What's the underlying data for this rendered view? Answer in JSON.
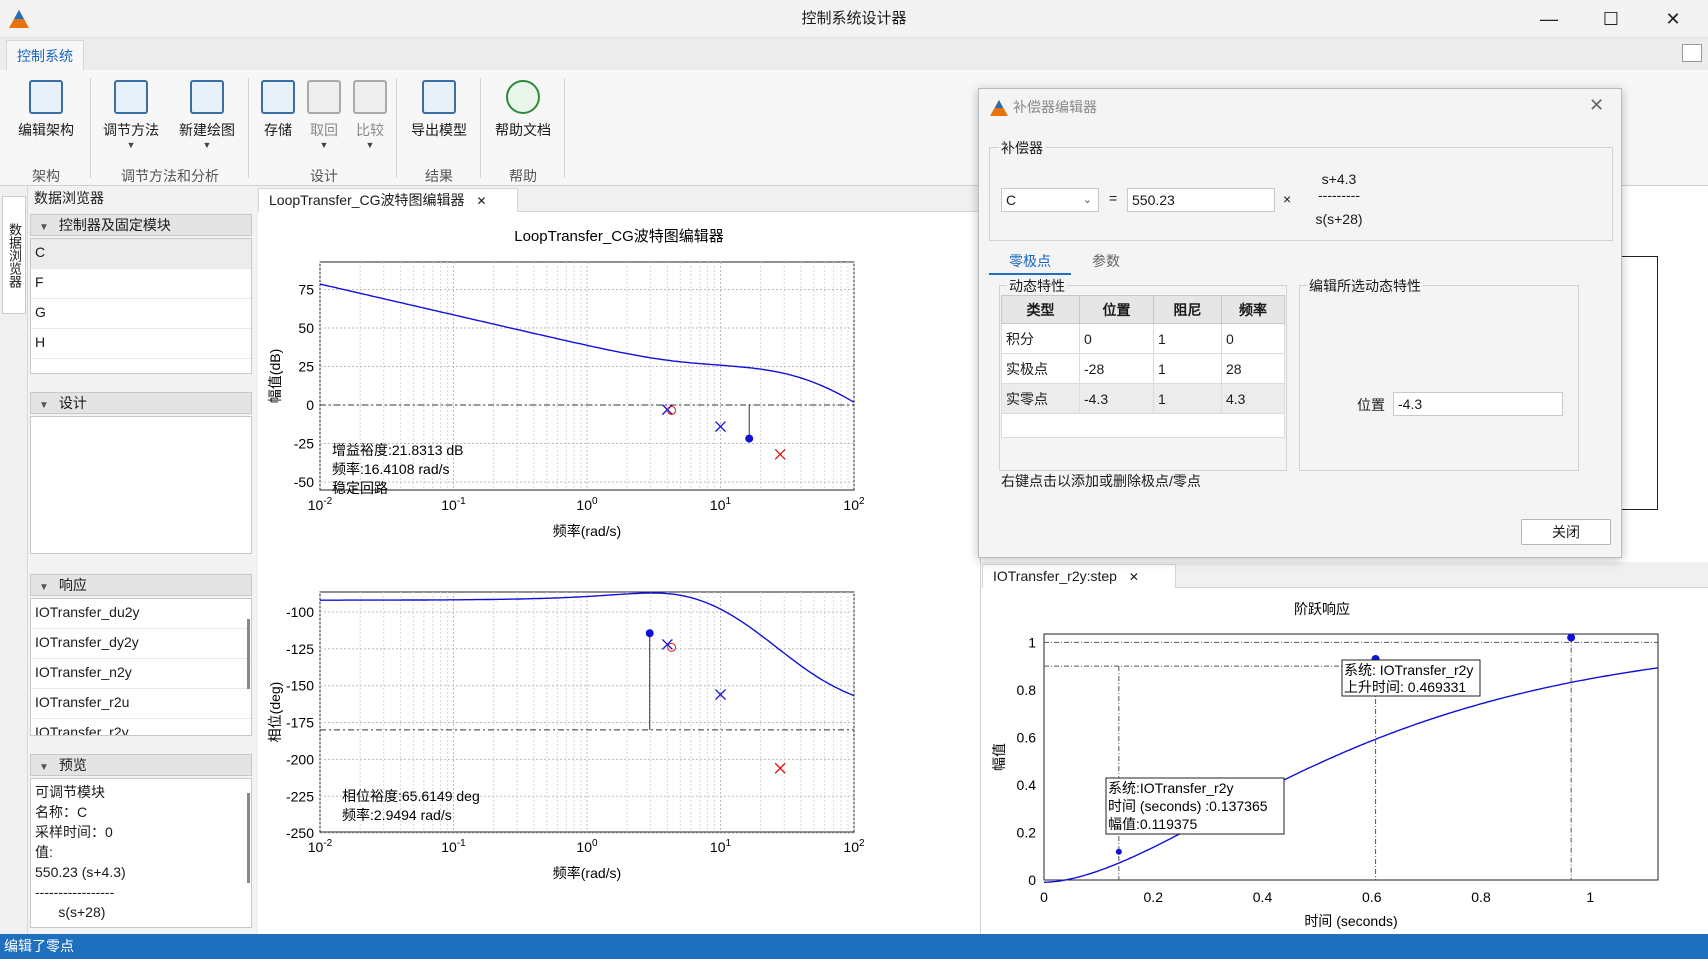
{
  "window": {
    "title": "控制系统设计器",
    "minimize": "—",
    "maximize": "☐",
    "close": "✕"
  },
  "ribbon": {
    "tab": "控制系统",
    "buttons": {
      "edit_arch": "编辑架构",
      "tuning": "调节方法",
      "new_plot": "新建绘图",
      "store": "存储",
      "retrieve": "取回",
      "compare": "比较",
      "export": "导出模型",
      "help": "帮助文档"
    },
    "groups": {
      "arch": "架构",
      "tuning": "调节方法和分析",
      "design": "设计",
      "results": "结果",
      "help": "帮助"
    }
  },
  "data_browser": {
    "side_tab": "数据浏览器",
    "title": "数据浏览器",
    "sec_controllers": "控制器及固定模块",
    "controllers": [
      "C",
      "F",
      "G",
      "H"
    ],
    "sec_design": "设计",
    "sec_responses": "响应",
    "responses": [
      "IOTransfer_du2y",
      "IOTransfer_dy2y",
      "IOTransfer_n2y",
      "IOTransfer_r2u",
      "IOTransfer_r2y"
    ],
    "sec_preview": "预览",
    "preview": [
      "可调节模块",
      "名称：C",
      "采样时间：0",
      "值:",
      "550.23 (s+4.3)",
      "-----------------",
      "      s(s+28)"
    ]
  },
  "bode": {
    "tab": "LoopTransfer_CG波特图编辑器",
    "title": "LoopTransfer_CG波特图编辑器",
    "mag_ylabel": "幅值(dB)",
    "phase_ylabel": "相位(deg)",
    "xlabel": "频率(rad/s)",
    "mag_ticks": [
      "75",
      "50",
      "25",
      "0",
      "-25",
      "-50"
    ],
    "phase_ticks": [
      "-100",
      "-125",
      "-150",
      "-175",
      "-200",
      "-225",
      "-250"
    ],
    "x_ticks": [
      "10",
      "10",
      "10",
      "10",
      "10"
    ],
    "x_exp": [
      "-2",
      "-1",
      "0",
      "1",
      "2"
    ],
    "gm_text": "增益裕度:21.8313 dB",
    "gm_freq": "频率:16.4108 rad/s",
    "gm_stable": "稳定回路",
    "pm_text": "相位裕度:65.6149 deg",
    "pm_freq": "频率:2.9494 rad/s"
  },
  "step": {
    "tab": "IOTransfer_r2y:step",
    "title": "阶跃响应",
    "ylabel": "幅值",
    "xlabel": "时间 (seconds)",
    "y_ticks": [
      "1",
      "0.8",
      "0.6",
      "0.4",
      "0.2",
      "0"
    ],
    "x_ticks": [
      "0",
      "0.2",
      "0.4",
      "0.6",
      "0.8",
      "1"
    ],
    "tip1": [
      "系统: IOTransfer_r2y",
      "上升时间: 0.469331"
    ],
    "tip2": [
      "系统:IOTransfer_r2y",
      "时间 (seconds) :0.137365",
      "幅值:0.119375"
    ]
  },
  "dialog": {
    "title": "补偿器编辑器",
    "close_x": "✕",
    "sec_comp": "补偿器",
    "comp_name": "C",
    "equals": "=",
    "gain": "550.23",
    "times": "×",
    "numerator": "s+4.3",
    "frac_line": "---------",
    "denominator": "s(s+28)",
    "tab_zp": "零极点",
    "tab_params": "参数",
    "sec_dyn": "动态特性",
    "cols": [
      "类型",
      "位置",
      "阻尼",
      "频率"
    ],
    "rows": [
      [
        "积分",
        "0",
        "1",
        "0"
      ],
      [
        "实极点",
        "-28",
        "1",
        "28"
      ],
      [
        "实零点",
        "-4.3",
        "1",
        "4.3"
      ]
    ],
    "hint": "右键点击以添加或删除极点/零点",
    "sec_edit": "编辑所选动态特性",
    "pos_label": "位置",
    "pos_value": "-4.3",
    "close_btn": "关闭"
  },
  "status": "编辑了零点"
}
